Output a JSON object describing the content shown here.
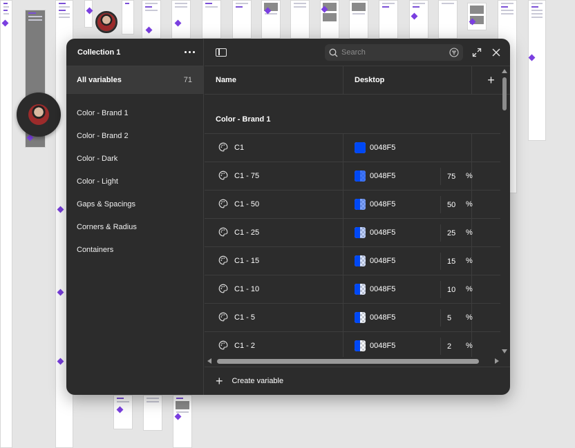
{
  "panel": {
    "collection_title": "Collection 1",
    "all_variables_label": "All variables",
    "all_variables_count": "71",
    "groups": [
      {
        "label": "Color - Brand 1"
      },
      {
        "label": "Color - Brand 2"
      },
      {
        "label": "Color - Dark"
      },
      {
        "label": "Color - Light"
      },
      {
        "label": "Gaps & Spacings"
      },
      {
        "label": "Corners & Radius"
      },
      {
        "label": "Containers"
      }
    ],
    "search_placeholder": "Search",
    "columns": {
      "name": "Name",
      "mode": "Desktop"
    },
    "group_heading": "Color - Brand 1",
    "rows": [
      {
        "name": "C1",
        "hex": "0048F5",
        "opacity": "",
        "pct": ""
      },
      {
        "name": "C1 - 75",
        "hex": "0048F5",
        "opacity": "75",
        "pct": "%"
      },
      {
        "name": "C1 - 50",
        "hex": "0048F5",
        "opacity": "50",
        "pct": "%"
      },
      {
        "name": "C1 - 25",
        "hex": "0048F5",
        "opacity": "25",
        "pct": "%"
      },
      {
        "name": "C1 - 15",
        "hex": "0048F5",
        "opacity": "15",
        "pct": "%"
      },
      {
        "name": "C1 - 10",
        "hex": "0048F5",
        "opacity": "10",
        "pct": "%"
      },
      {
        "name": "C1 - 5",
        "hex": "0048F5",
        "opacity": "5",
        "pct": "%"
      },
      {
        "name": "C1 - 2",
        "hex": "0048F5",
        "opacity": "2",
        "pct": "%"
      }
    ],
    "create_variable_label": "Create variable"
  },
  "colors": {
    "brand": "#0048F5",
    "panel_bg": "#2C2C2C",
    "canvas_bg": "#E5E5E5",
    "canvas_accent": "#7A3FE0"
  },
  "icons": [
    "more-icon",
    "sidebar-toggle-icon",
    "search-icon",
    "filter-icon",
    "expand-icon",
    "close-icon",
    "add-icon",
    "palette-icon"
  ]
}
